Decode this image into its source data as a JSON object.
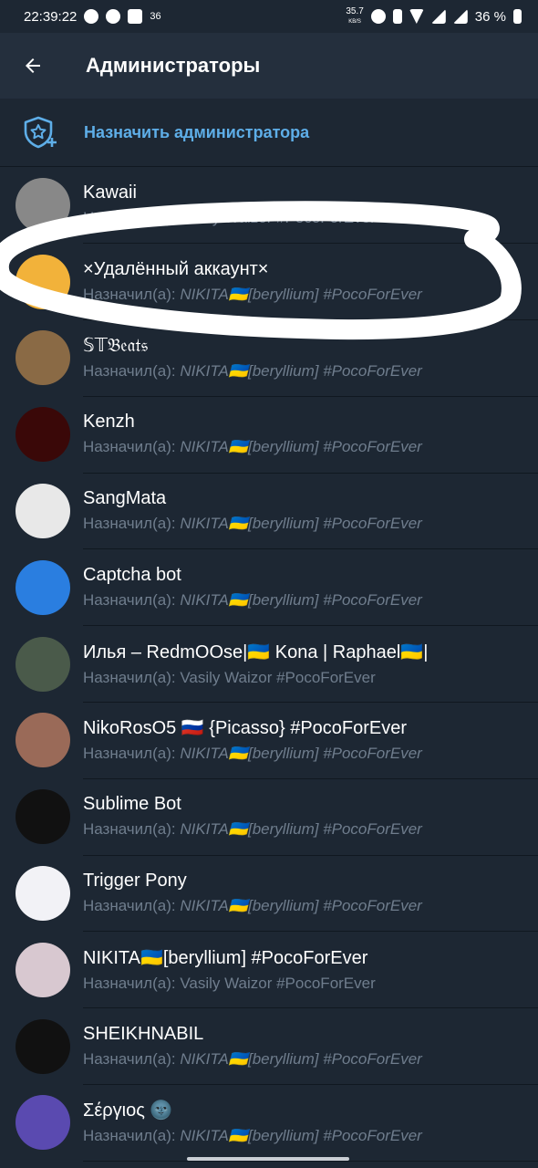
{
  "status_bar": {
    "time": "22:39:22",
    "notif_count": "36",
    "net_speed": "35.7",
    "net_unit": "KB/S",
    "battery": "36 %"
  },
  "header": {
    "title": "Администраторы",
    "back_icon": "arrow-left-icon"
  },
  "assign": {
    "label": "Назначить администратора",
    "icon": "shield-star-plus-icon"
  },
  "colors": {
    "background": "#1d2733",
    "header": "#242f3d",
    "accent": "#5eaee8",
    "subtitle": "#6f7d8d"
  },
  "admins": [
    {
      "name": "Kawaii",
      "sub_prefix": "Назначил(а):",
      "sub_by": "Vasily Waizor #PocoForEver",
      "avatar_color": "#888"
    },
    {
      "name": "×Удалённый аккаунт×",
      "sub_prefix": "Назначил(а):",
      "sub_by": "NIKITA🇺🇦[beryllium] #PocoForEver",
      "avatar_color": "#f2b23a"
    },
    {
      "name": "𝕊𝕋𝔅𝔢𝔞𝔱𝔰",
      "sub_prefix": "Назначил(а):",
      "sub_by": "NIKITA🇺🇦[beryllium] #PocoForEver",
      "avatar_color": "#8a6a45"
    },
    {
      "name": "Kenzh",
      "sub_prefix": "Назначил(а):",
      "sub_by": "NIKITA🇺🇦[beryllium] #PocoForEver",
      "avatar_color": "#3a0808"
    },
    {
      "name": "SangMata",
      "sub_prefix": "Назначил(а):",
      "sub_by": "NIKITA🇺🇦[beryllium] #PocoForEver",
      "avatar_color": "#e8e8e8"
    },
    {
      "name": "Captcha bot",
      "sub_prefix": "Назначил(а):",
      "sub_by": "NIKITA🇺🇦[beryllium] #PocoForEver",
      "avatar_color": "#2a7ee0"
    },
    {
      "name": "Илья – RedmOOse|🇺🇦 Kona | Raphael🇺🇦|",
      "sub_prefix": "Назначил(а):",
      "sub_by": "Vasily Waizor #PocoForEver",
      "avatar_color": "#4a5a4a"
    },
    {
      "name": "NikoRosO5 🇷🇺 {Picasso} #PocoForEver",
      "sub_prefix": "Назначил(а):",
      "sub_by": "NIKITA🇺🇦[beryllium] #PocoForEver",
      "avatar_color": "#9a6a58"
    },
    {
      "name": "Sublime Bot",
      "sub_prefix": "Назначил(а):",
      "sub_by": "NIKITA🇺🇦[beryllium] #PocoForEver",
      "avatar_color": "#111"
    },
    {
      "name": "Trigger Pony",
      "sub_prefix": "Назначил(а):",
      "sub_by": "NIKITA🇺🇦[beryllium] #PocoForEver",
      "avatar_color": "#f2f2f6"
    },
    {
      "name": "NIKITA🇺🇦[beryllium] #PocoForEver",
      "sub_prefix": "Назначил(а):",
      "sub_by": "Vasily Waizor #PocoForEver",
      "avatar_color": "#d8c8d0"
    },
    {
      "name": "SHEIKHNABIL",
      "sub_prefix": "Назначил(а):",
      "sub_by": "NIKITA🇺🇦[beryllium] #PocoForEver",
      "avatar_color": "#111"
    },
    {
      "name": "Σέργιος 🌚",
      "sub_prefix": "Назначил(а):",
      "sub_by": "NIKITA🇺🇦[beryllium] #PocoForEver",
      "avatar_color": "#5a4ab0"
    }
  ]
}
